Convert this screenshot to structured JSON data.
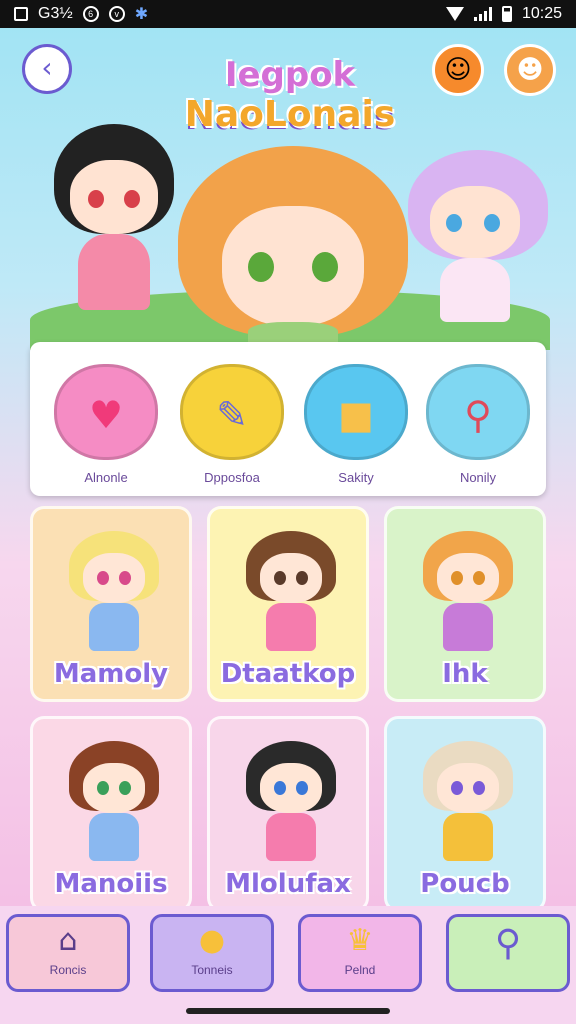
{
  "status_bar": {
    "left_text": "G3½",
    "time": "10:25"
  },
  "header": {
    "title_line1": "Iegpok",
    "title_line2": "NaoLonais"
  },
  "icons": {
    "back": "back-arrow-icon",
    "mascot": "orange-mascot-icon",
    "profile": "profile-avatar-icon"
  },
  "categories": [
    {
      "label": "Alnonle",
      "color": "#f58cc4",
      "icon": "heart-icon"
    },
    {
      "label": "Dpposfoa",
      "color": "#f7d23a",
      "icon": "pencil-icon"
    },
    {
      "label": "Sakity",
      "color": "#59c7f0",
      "icon": "box-icon"
    },
    {
      "label": "Nonily",
      "color": "#7fd7f2",
      "icon": "wand-icon"
    }
  ],
  "characters": [
    {
      "name": "Mamoly",
      "card_bg": "#fbe0b4",
      "hair": "#f6e27a",
      "dress": "#8ab8f0",
      "eyes": "#d84a8a"
    },
    {
      "name": "Dtaatkop",
      "card_bg": "#fdf3b3",
      "hair": "#7a4a2a",
      "dress": "#f57cad",
      "eyes": "#5a3a2a"
    },
    {
      "name": "Ihk",
      "card_bg": "#d9f3c9",
      "hair": "#f1a54a",
      "dress": "#c77bd8",
      "eyes": "#e0902a"
    },
    {
      "name": "Manoiis",
      "card_bg": "#fbd8e6",
      "hair": "#8a4226",
      "dress": "#8ab8f0",
      "eyes": "#3aa05a"
    },
    {
      "name": "Mlolufax",
      "card_bg": "#f8d6ea",
      "hair": "#2a2a2a",
      "dress": "#f57cad",
      "eyes": "#3a78d8"
    },
    {
      "name": "Poucb",
      "card_bg": "#c8ecf6",
      "hair": "#eadbc2",
      "dress": "#f4c03a",
      "eyes": "#7a5ad8"
    }
  ],
  "nav": [
    {
      "label": "Roncis",
      "bg": "#f7c8d8",
      "icon": "home-icon"
    },
    {
      "label": "Tonneis",
      "bg": "#c9b4f2",
      "icon": "chat-bubble-icon"
    },
    {
      "label": "Pelnd",
      "bg": "#f2b6e8",
      "icon": "crown-icon"
    },
    {
      "label": "",
      "bg": "#c9efb9",
      "icon": "search-icon"
    }
  ]
}
